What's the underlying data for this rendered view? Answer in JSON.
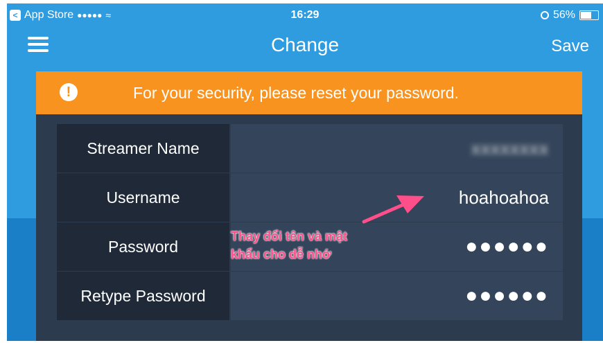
{
  "status_bar": {
    "back_app": "App Store",
    "signal": "●●●●●",
    "time": "16:29",
    "battery": "56%"
  },
  "nav": {
    "title": "Change",
    "save_label": "Save"
  },
  "banner": {
    "icon": "!",
    "message": "For your security, please reset your password."
  },
  "form": {
    "rows": [
      {
        "label": "Streamer Name",
        "value": "xxxxxxxx"
      },
      {
        "label": "Username",
        "value": "hoahoahoa"
      },
      {
        "label": "Password",
        "value": "●●●●●●"
      },
      {
        "label": "Retype Password",
        "value": "●●●●●●"
      }
    ]
  },
  "annotation": {
    "line1": "Thay đổi tên và mật",
    "line2": "khẩu cho dễ nhớ",
    "color": "#ff4f8b"
  },
  "colors": {
    "accent": "#2f9ce0",
    "banner": "#f7931e",
    "card": "#2d3b4f"
  }
}
